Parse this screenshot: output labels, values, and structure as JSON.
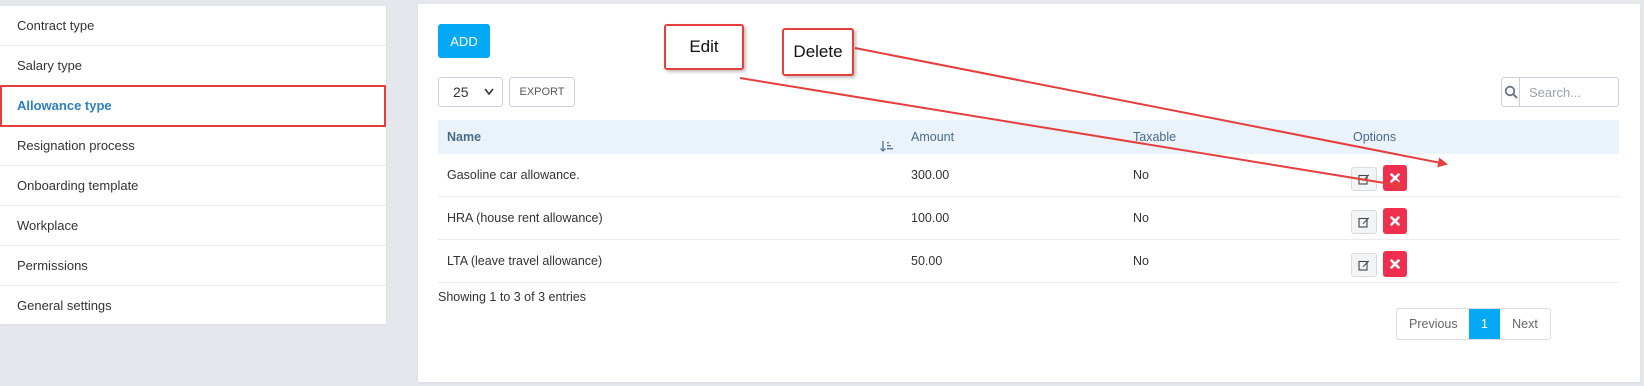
{
  "sidebar": {
    "items": [
      {
        "label": "Contract type"
      },
      {
        "label": "Salary type"
      },
      {
        "label": "Allowance type"
      },
      {
        "label": "Resignation process"
      },
      {
        "label": "Onboarding template"
      },
      {
        "label": "Workplace"
      },
      {
        "label": "Permissions"
      },
      {
        "label": "General settings"
      }
    ],
    "active": "Allowance type"
  },
  "toolbar": {
    "add_label": "ADD",
    "page_length": "25",
    "export_label": "EXPORT",
    "search_placeholder": "Search..."
  },
  "table": {
    "columns": [
      "Name",
      "Amount",
      "Taxable",
      "Options"
    ],
    "rows": [
      {
        "name": "Gasoline car allowance.",
        "amount": "300.00",
        "taxable": "No"
      },
      {
        "name": "HRA (house rent allowance)",
        "amount": "100.00",
        "taxable": "No"
      },
      {
        "name": "LTA (leave travel allowance)",
        "amount": "50.00",
        "taxable": "No"
      }
    ]
  },
  "footer": {
    "info": "Showing 1 to 3 of 3 entries",
    "previous_label": "Previous",
    "current_page": "1",
    "next_label": "Next"
  },
  "annotations": {
    "edit_label": "Edit",
    "delete_label": "Delete"
  },
  "colors": {
    "accent": "#03a9f4",
    "active_link": "#2d7fc1",
    "delete": "#ee2f4d",
    "highlight": "#e53e3e",
    "header_bg": "#eaf3fb"
  },
  "icons": {
    "search": "search-icon",
    "edit": "edit-icon",
    "delete": "close-icon",
    "sort": "sort-icon"
  }
}
